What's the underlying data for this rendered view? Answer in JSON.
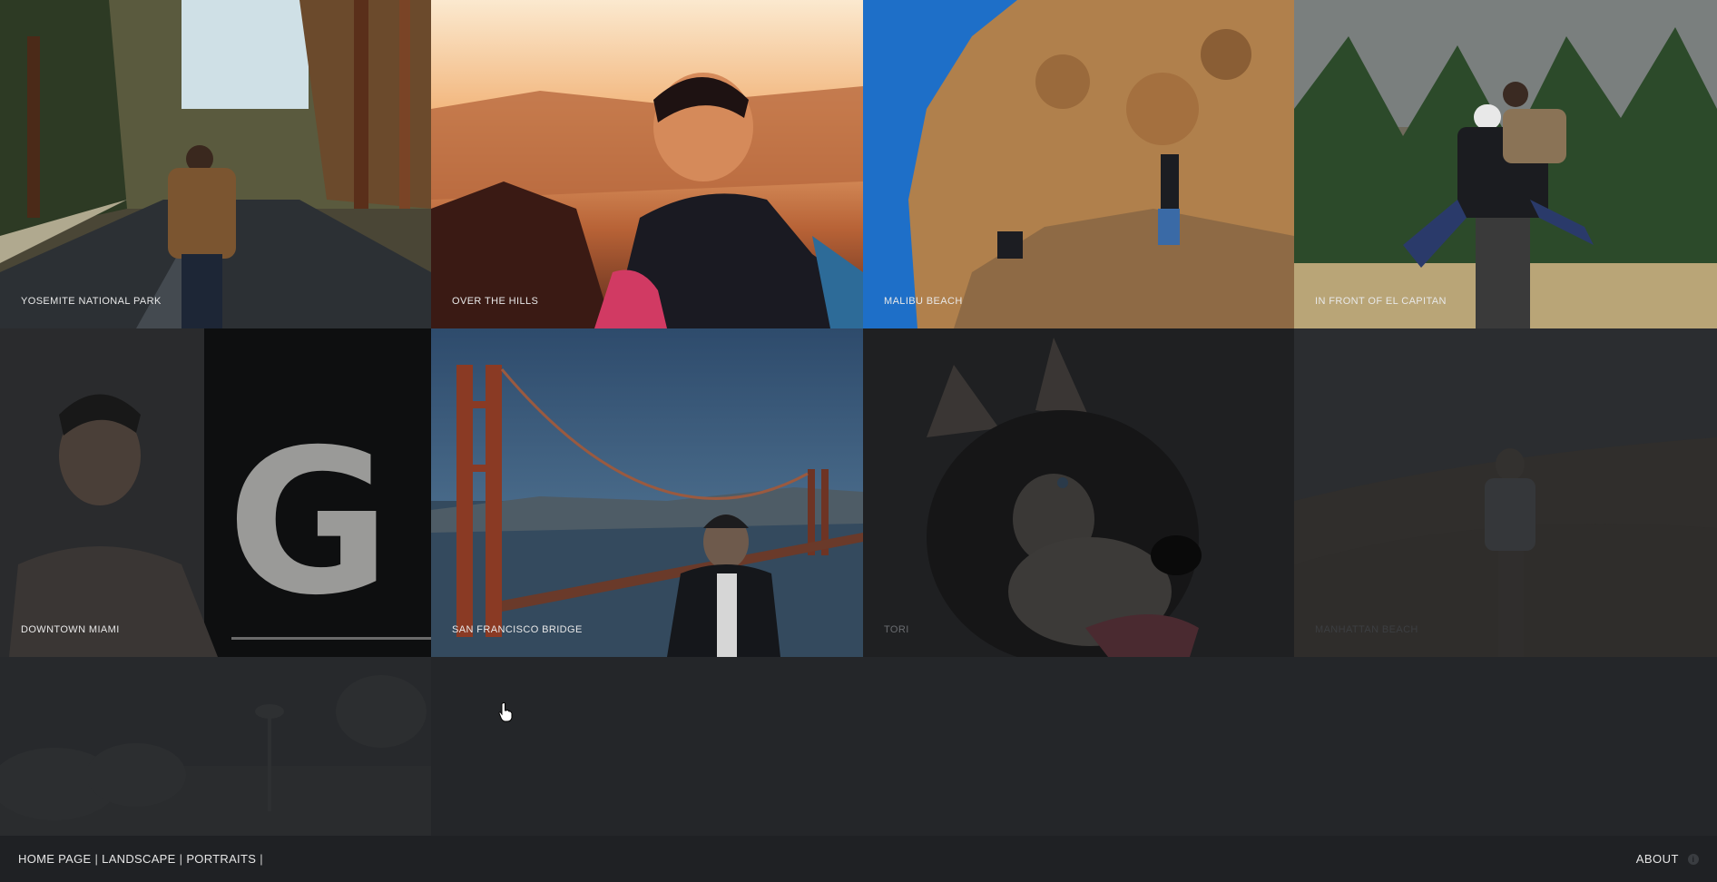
{
  "gallery": {
    "tiles": [
      {
        "caption": "Yosemite National Park"
      },
      {
        "caption": "Over the Hills"
      },
      {
        "caption": "Malibu Beach"
      },
      {
        "caption": "In Front of El Capitan"
      },
      {
        "caption": "Downtown Miami"
      },
      {
        "caption": "San Francisco Bridge"
      },
      {
        "caption": "Tori"
      },
      {
        "caption": "Manhattan Beach"
      },
      {
        "caption": ""
      }
    ]
  },
  "footer": {
    "nav": [
      {
        "label": "HOME PAGE"
      },
      {
        "label": "LANDSCAPE"
      },
      {
        "label": "PORTRAITS"
      }
    ],
    "separator": "|",
    "about_label": "ABOUT",
    "info_icon": "info-icon"
  },
  "colors": {
    "background": "#242629",
    "footer_bg": "#1f2124",
    "caption_text": "#e8e8e8"
  }
}
